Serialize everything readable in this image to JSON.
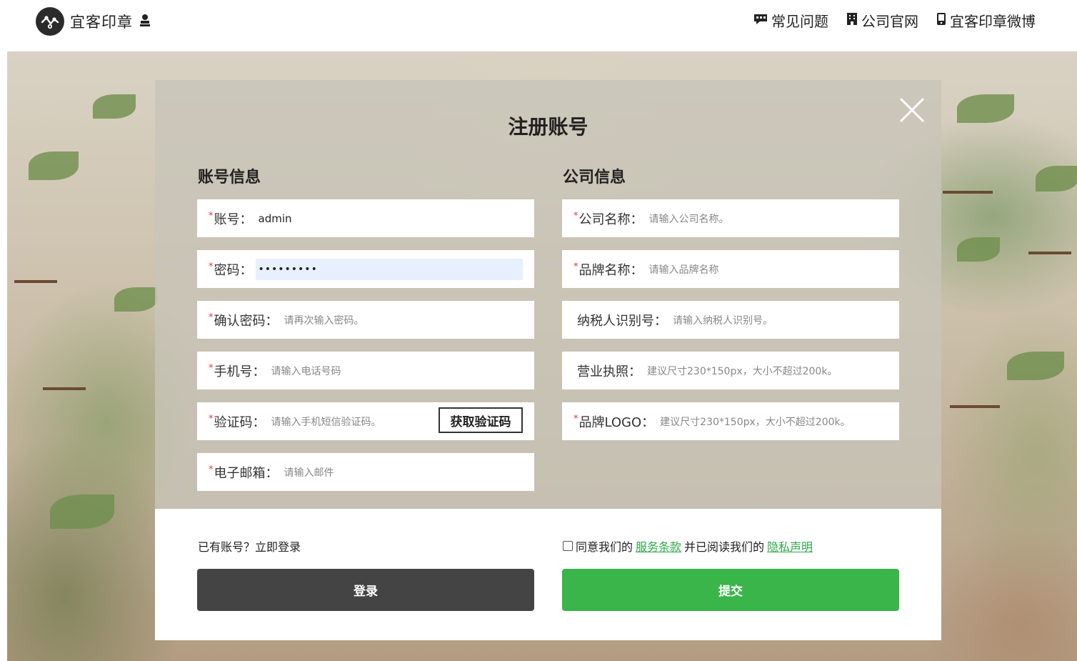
{
  "header": {
    "brand": "宜客印章",
    "nav": [
      {
        "icon": "chat-icon",
        "label": "常见问题"
      },
      {
        "icon": "building-icon",
        "label": "公司官网"
      },
      {
        "icon": "weibo-icon",
        "label": "宜客印章微博"
      }
    ]
  },
  "modal": {
    "title": "注册账号",
    "account_section": "账号信息",
    "company_section": "公司信息",
    "account_fields": {
      "username": {
        "label": "账号",
        "value": "admin",
        "placeholder": ""
      },
      "password": {
        "label": "密码",
        "value": "•••••••••",
        "placeholder": ""
      },
      "confirm": {
        "label": "确认密码",
        "placeholder": "请再次输入密码。"
      },
      "phone": {
        "label": "手机号",
        "placeholder": "请输入电话号码"
      },
      "code": {
        "label": "验证码",
        "placeholder": "请输入手机短信验证码。",
        "button": "获取验证码"
      },
      "email": {
        "label": "电子邮箱",
        "placeholder": "请输入邮件"
      }
    },
    "company_fields": {
      "company_name": {
        "label": "公司名称",
        "placeholder": "请输入公司名称。"
      },
      "brand_name": {
        "label": "品牌名称",
        "placeholder": "请输入品牌名称"
      },
      "tax_id": {
        "label": "纳税人识别号",
        "placeholder": "请输入纳税人识别号。"
      },
      "license": {
        "label": "营业执照",
        "placeholder": "建议尺寸230*150px，大小不超过200k。"
      },
      "logo": {
        "label": "品牌LOGO",
        "placeholder": "建议尺寸230*150px，大小不超过200k。"
      }
    },
    "login_prompt": "已有账号？立即登录",
    "agree_prefix": "同意我们的",
    "terms_link": "服务条款",
    "agree_middle": "并已阅读我们的",
    "privacy_link": "隐私声明",
    "login_button": "登录",
    "submit_button": "提交"
  },
  "colors": {
    "required": "#e0393e",
    "login_button": "#444444",
    "submit_button": "#39b54a",
    "link": "#2ea84a"
  }
}
